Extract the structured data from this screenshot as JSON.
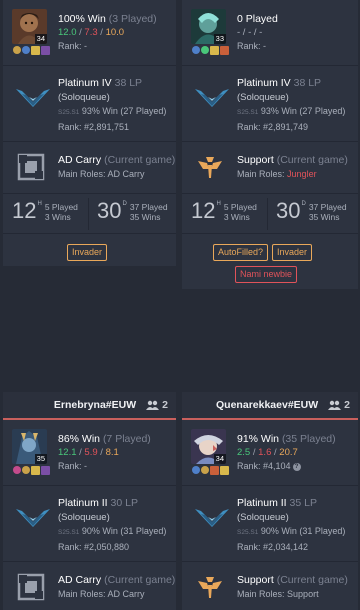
{
  "players": [
    {
      "header": null,
      "champion": {
        "icon": "champion-portrait",
        "level": "34"
      },
      "win_rate": "100% Win",
      "games_played": "(3 Played)",
      "kda": {
        "k": "12.0",
        "d": "7.3",
        "a": "10.0"
      },
      "rank_text": "Rank: -",
      "tier": {
        "name": "Platinum IV",
        "lp": "38 LP",
        "queue": "(Soloqueue)",
        "season": "S25.S1",
        "season_record": "93% Win (27 Played)",
        "ladder_rank": "Rank: #2,891,751"
      },
      "role": {
        "name": "AD Carry",
        "current": "(Current game)",
        "main_label": "Main Roles:",
        "main_value": "AD Carry",
        "icon": "adc-role-icon"
      },
      "stats": [
        {
          "big": "12",
          "sup": "H",
          "line1": "5 Played",
          "line2": "3 Wins"
        },
        {
          "big": "30",
          "sup": "D",
          "line1": "37 Played",
          "line2": "35 Wins"
        }
      ],
      "tags": [
        "Invader"
      ]
    },
    {
      "header": null,
      "champion": {
        "icon": "champion-portrait",
        "level": "33"
      },
      "win_rate": "0 Played",
      "games_played": "",
      "kda_none": "- / - / -",
      "rank_text": "Rank: -",
      "tier": {
        "name": "Platinum IV",
        "lp": "38 LP",
        "queue": "(Soloqueue)",
        "season": "S25.S1",
        "season_record": "93% Win (27 Played)",
        "ladder_rank": "Rank: #2,891,749"
      },
      "role": {
        "name": "Support",
        "current": "(Current game)",
        "main_label": "Main Roles:",
        "main_value": "Jungler",
        "icon": "support-role-icon"
      },
      "stats": [
        {
          "big": "12",
          "sup": "H",
          "line1": "5 Played",
          "line2": "3 Wins"
        },
        {
          "big": "30",
          "sup": "D",
          "line1": "37 Played",
          "line2": "35 Wins"
        }
      ],
      "tags": [
        "AutoFilled?",
        "Invader"
      ],
      "tags2": [
        "Nami newbie"
      ]
    },
    {
      "header": {
        "name": "Ernebryna#EUW",
        "group": "2"
      },
      "champion": {
        "icon": "champion-portrait",
        "level": "35"
      },
      "win_rate": "86% Win",
      "games_played": "(7 Played)",
      "kda": {
        "k": "12.1",
        "d": "5.9",
        "a": "8.1"
      },
      "rank_text": "Rank: -",
      "tier": {
        "name": "Platinum II",
        "lp": "30 LP",
        "queue": "(Soloqueue)",
        "season": "S25.S1",
        "season_record": "90% Win (31 Played)",
        "ladder_rank": "Rank: #2,050,880"
      },
      "role": {
        "name": "AD Carry",
        "current": "(Current game)",
        "main_label": "Main Roles:",
        "main_value": "AD Carry",
        "icon": "adc-role-icon"
      }
    },
    {
      "header": {
        "name": "Quenarekkaev#EUW",
        "group": "2"
      },
      "champion": {
        "icon": "champion-portrait",
        "level": "34"
      },
      "win_rate": "91% Win",
      "games_played": "(35 Played)",
      "kda": {
        "k": "2.5",
        "d": "1.6",
        "a": "20.7"
      },
      "rank_text": "Rank: #4,104",
      "tier": {
        "name": "Platinum II",
        "lp": "35 LP",
        "queue": "(Soloqueue)",
        "season": "S25.S1",
        "season_record": "90% Win (31 Played)",
        "ladder_rank": "Rank: #2,034,142"
      },
      "role": {
        "name": "Support",
        "current": "(Current game)",
        "main_label": "Main Roles:",
        "main_value": "Support",
        "icon": "support-role-icon"
      }
    }
  ],
  "colors": {
    "accent_red": "#c9605d",
    "win_green": "#49c77a",
    "death_red": "#e0535a",
    "assist_orange": "#e9a85a",
    "tier_blue": "#3f8fc0"
  }
}
